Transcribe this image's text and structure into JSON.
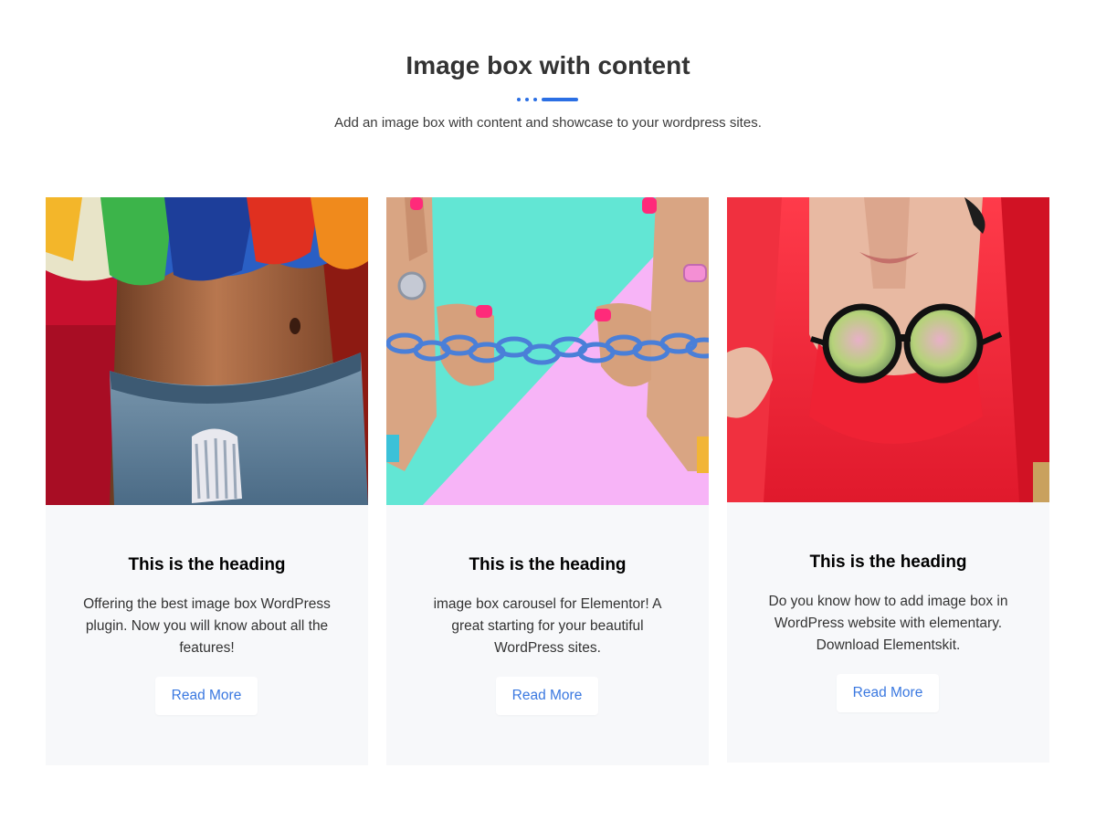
{
  "section": {
    "title": "Image box with content",
    "subtitle": "Add an image box with content and showcase to your wordpress sites.",
    "accent_color": "#2b6fe4"
  },
  "cards": [
    {
      "image": "colorful-fur-midriff-jeans-photo",
      "heading": "This is the heading",
      "text": "Offering the best image box WordPress plugin. Now you will know about all the features!",
      "button": "Read More"
    },
    {
      "image": "hands-with-blue-chain-on-mint-pink-photo",
      "heading": "This is the heading",
      "text": "image box carousel for Elementor! A great starting for your beautiful WordPress sites.",
      "button": "Read More"
    },
    {
      "image": "red-hair-woman-round-sunglasses-photo",
      "heading": "This is the heading",
      "text": "Do you know how to add image box in WordPress website with elementary. Download Elementskit.",
      "button": "Read More"
    }
  ]
}
